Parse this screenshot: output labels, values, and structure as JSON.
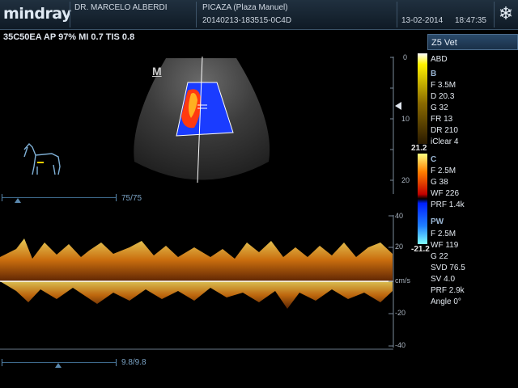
{
  "header": {
    "brand": "mindray",
    "doctor": "DR. MARCELO  ALBERDI",
    "patient": "PICAZA (Plaza Manuel)",
    "exam_id": "20140213-183515-0C4D",
    "date": "13-02-2014",
    "time": "18:47:35",
    "freeze_icon": "snowflake-icon"
  },
  "acq_params": "35C50EA  AP 97%  MI 0.7 TIS 0.8",
  "body_marker": "M",
  "patient_icon": "horse-icon",
  "probe": "Z5 Vet",
  "b_mode": {
    "preset": "ABD",
    "title": "B",
    "lines": [
      "F 3.5M",
      "D 20.3",
      "G 32",
      "FR 13",
      "DR 210",
      "iClear 4"
    ]
  },
  "color_mode": {
    "title": "C",
    "lines": [
      "F 2.5M",
      "G 38",
      "WF 226",
      "PRF 1.4k"
    ]
  },
  "pw_mode": {
    "title": "PW",
    "lines": [
      "F 2.5M",
      "WF 119",
      "G 22",
      "SVD 76.5",
      "SV 4.0",
      "PRF 2.9k",
      "Angle 0°"
    ]
  },
  "color_scale": {
    "max": "21.2",
    "min": "-21.2"
  },
  "depth_scale": [
    "0",
    "10",
    "20"
  ],
  "velocity_scale": {
    "labels": [
      "40",
      "20",
      "cm/s",
      "-20",
      "-40"
    ],
    "unit": "cm/s"
  },
  "slider_top": {
    "label": "75/75"
  },
  "slider_bottom": {
    "label": "9.8/9.8"
  },
  "colors": {
    "doppler_blue": "#1a3cff",
    "doppler_red": "#ff3a10",
    "spectrum_orange": "#f2a21a"
  }
}
